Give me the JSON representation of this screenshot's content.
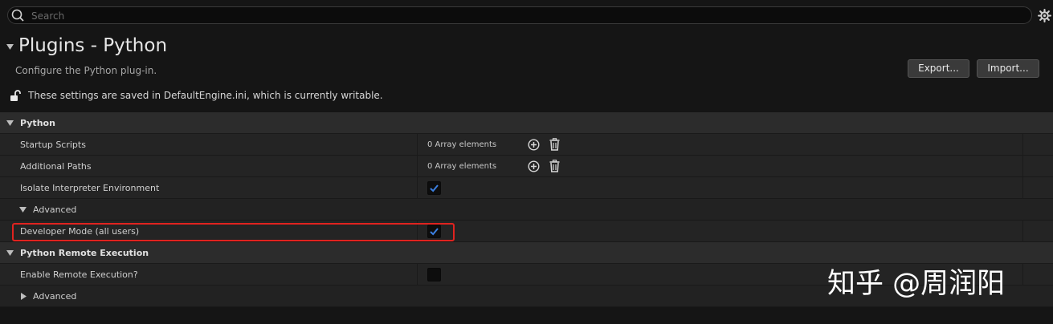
{
  "search": {
    "placeholder": "Search"
  },
  "header": {
    "title": "Plugins - Python",
    "description": "Configure the Python plug-in.",
    "export_label": "Export...",
    "import_label": "Import...",
    "config_note": "These settings are saved in DefaultEngine.ini, which is currently writable."
  },
  "sections": {
    "python": {
      "label": "Python",
      "rows": {
        "startup_scripts": {
          "label": "Startup Scripts",
          "value": "0 Array elements"
        },
        "additional_paths": {
          "label": "Additional Paths",
          "value": "0 Array elements"
        },
        "isolate_env": {
          "label": "Isolate Interpreter Environment",
          "checked": true
        },
        "advanced": {
          "label": "Advanced",
          "expanded": true
        },
        "developer_mode": {
          "label": "Developer Mode (all users)",
          "checked": true
        }
      }
    },
    "remote": {
      "label": "Python Remote Execution",
      "rows": {
        "enable_remote": {
          "label": "Enable Remote Execution?",
          "checked": false
        },
        "advanced": {
          "label": "Advanced",
          "expanded": false
        }
      }
    }
  },
  "watermark": "知乎 @周润阳",
  "colors": {
    "highlight": "#e0231f",
    "check": "#3b7fe0"
  }
}
